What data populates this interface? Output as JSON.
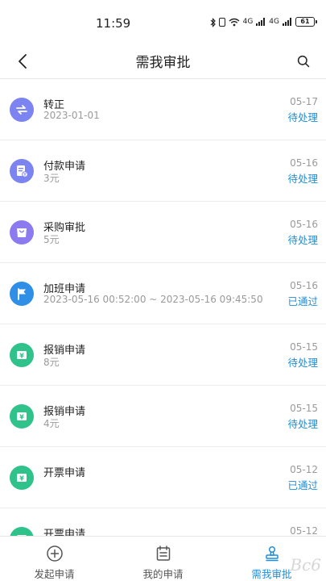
{
  "status_bar": {
    "time": "11:59",
    "network_1": "4G",
    "network_2": "4G",
    "battery": "61"
  },
  "header": {
    "title": "需我审批",
    "back_icon": "chevron-left-icon",
    "search_icon": "search-icon"
  },
  "approvals": [
    {
      "title": "转正",
      "subtitle": "2023-01-01",
      "date": "05-17",
      "status": "待处理",
      "icon": "transfer-icon",
      "color": "#7b84f0"
    },
    {
      "title": "付款申请",
      "subtitle": "3元",
      "date": "05-16",
      "status": "待处理",
      "icon": "payment-icon",
      "color": "#7b84f0"
    },
    {
      "title": "采购审批",
      "subtitle": "5元",
      "date": "05-16",
      "status": "待处理",
      "icon": "shopping-bag-icon",
      "color": "#8c7af0"
    },
    {
      "title": "加班申请",
      "subtitle": "2023-05-16 00:52:00 ~ 2023-05-16 09:45:50",
      "date": "05-16",
      "status": "已通过",
      "icon": "flag-icon",
      "color": "#2f8fe6"
    },
    {
      "title": "报销申请",
      "subtitle": "8元",
      "date": "05-15",
      "status": "待处理",
      "icon": "ticket-icon",
      "color": "#2fc28b"
    },
    {
      "title": "报销申请",
      "subtitle": "4元",
      "date": "05-15",
      "status": "待处理",
      "icon": "ticket-icon",
      "color": "#2fc28b"
    },
    {
      "title": "开票申请",
      "subtitle": "",
      "date": "05-12",
      "status": "已通过",
      "icon": "ticket-icon",
      "color": "#2fc28b"
    },
    {
      "title": "开票申请",
      "subtitle": "",
      "date": "05-12",
      "status": "",
      "icon": "ticket-icon",
      "color": "#2fc28b"
    }
  ],
  "tabs": [
    {
      "label": "发起申请",
      "icon": "plus-circle-icon",
      "active": false
    },
    {
      "label": "我的申请",
      "icon": "calendar-list-icon",
      "active": false
    },
    {
      "label": "需我审批",
      "icon": "approval-stamp-icon",
      "active": true
    }
  ],
  "watermark": "Bc6",
  "colors": {
    "accent": "#1f8fd8",
    "muted": "#9a9a9a"
  }
}
